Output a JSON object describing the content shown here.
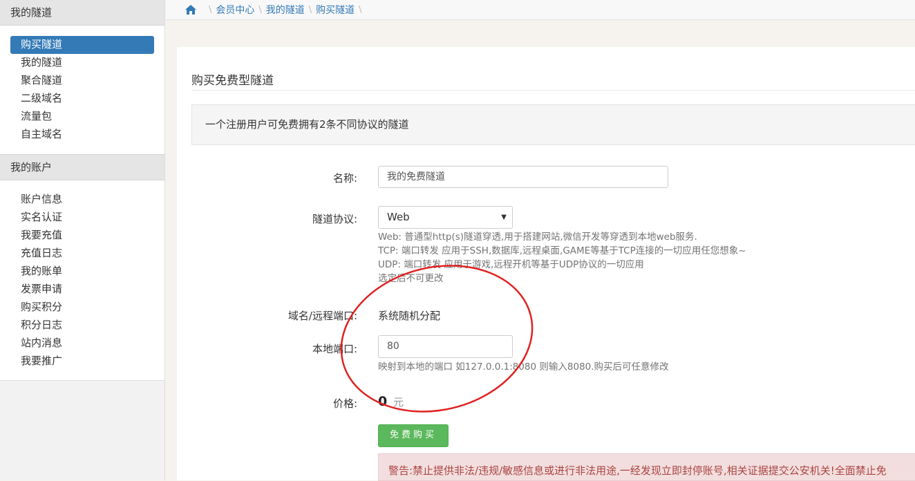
{
  "sidebar": {
    "sections": [
      {
        "title": "我的隧道",
        "items": [
          "购买隧道",
          "我的隧道",
          "聚合隧道",
          "二级域名",
          "流量包",
          "自主域名"
        ]
      },
      {
        "title": "我的账户",
        "items": [
          "账户信息",
          "实名认证",
          "我要充值",
          "充值日志",
          "我的账单",
          "发票申请",
          "购买积分",
          "积分日志",
          "站内消息",
          "我要推广"
        ]
      }
    ],
    "active_item": "购买隧道"
  },
  "breadcrumb": [
    "会员中心",
    "我的隧道",
    "购买隧道"
  ],
  "panel": {
    "title": "购买免费型隧道",
    "notice": "一个注册用户可免费拥有2条不同协议的隧道"
  },
  "form": {
    "name_label": "名称:",
    "name_value": "我的免费隧道",
    "protocol_label": "隧道协议:",
    "protocol_value": "Web",
    "protocol_help": [
      "Web: 普通型http(s)隧道穿透,用于搭建网站,微信开发等穿透到本地web服务.",
      "TCP: 端口转发 应用于SSH,数据库,远程桌面,GAME等基于TCP连接的一切应用任您想象~",
      "UDP: 端口转发 应用于游戏,远程开机等基于UDP协议的一切应用",
      "选定后不可更改"
    ],
    "domain_label": "域名/远程端口:",
    "domain_value": "系统随机分配",
    "local_port_label": "本地端口:",
    "local_port_value": "80",
    "local_port_help": "映射到本地的端口 如127.0.0.1:8080 则输入8080.购买后可任意修改",
    "price_label": "价格:",
    "price_value": "0",
    "price_unit": "元",
    "buy_button": "免费购买"
  },
  "warning": "警告:禁止提供非法/违规/敏感信息或进行非法用途,一经发现立即封停账号,相关证据提交公安机关!全面禁止免",
  "colors": {
    "primary": "#337ab7",
    "success": "#5cb85c",
    "danger_bg": "#f2dede",
    "danger_text": "#a94442",
    "annotation": "#e02020"
  }
}
